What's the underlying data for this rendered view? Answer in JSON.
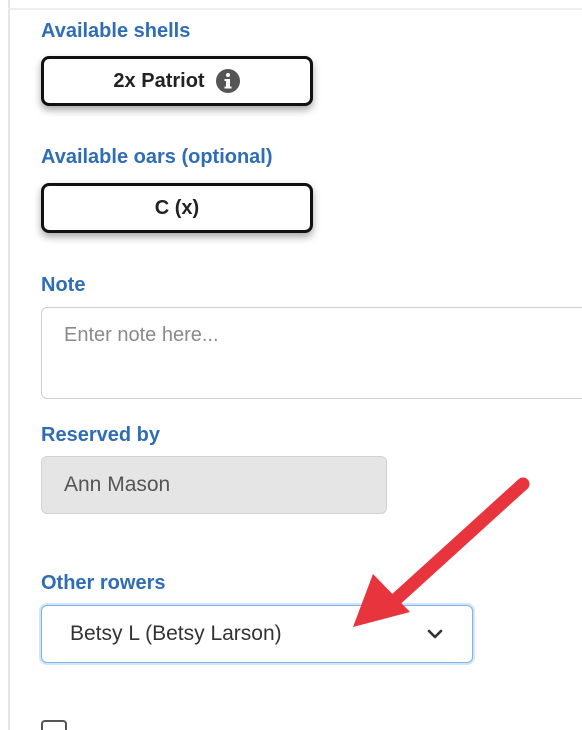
{
  "form": {
    "shells_label": "Available shells",
    "shell_selected": "2x Patriot",
    "oars_label": "Available oars (optional)",
    "oar_selected": "C (x)",
    "note_label": "Note",
    "note_placeholder": "Enter note here...",
    "reserved_label": "Reserved by",
    "reserved_value": "Ann Mason",
    "rowers_label": "Other rowers",
    "rowers_selected": "Betsy L (Betsy Larson)"
  },
  "icons": {
    "info": "info-circle-icon",
    "chevron": "chevron-down-icon",
    "annotation": "red-arrow-annotation"
  },
  "colors": {
    "label": "#2f6db5",
    "arrow": "#e8343c",
    "focus_border": "#7fb1ea"
  }
}
